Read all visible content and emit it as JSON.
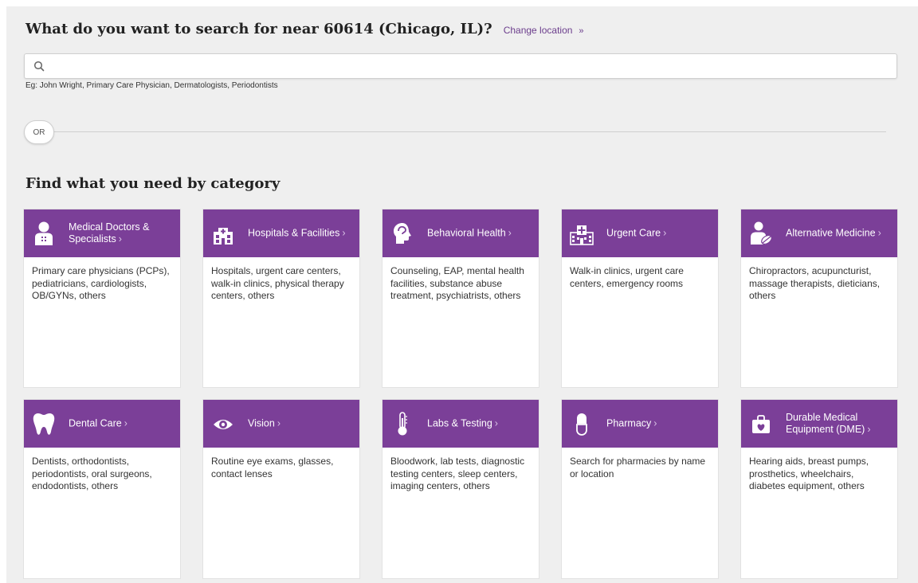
{
  "header": {
    "question": "What do you want to search for near 60614 (Chicago, IL)?",
    "change_location": "Change location",
    "change_chevron": "»"
  },
  "search": {
    "value": "",
    "placeholder": "",
    "hint": "Eg: John Wright, Primary Care Physician, Dermatologists, Periodontists"
  },
  "divider": {
    "or_label": "OR"
  },
  "categories_section": {
    "heading": "Find what you need by category",
    "chevron": "›",
    "accent_color": "#7b3f98",
    "items": [
      {
        "title": "Medical Doctors & Specialists",
        "icon": "doctor-icon",
        "description": "Primary care physicians (PCPs), pediatricians, cardiologists, OB/GYNs, others"
      },
      {
        "title": "Hospitals & Facilities",
        "icon": "hospital-building-icon",
        "description": "Hospitals, urgent care centers, walk-in clinics, physical therapy centers, others"
      },
      {
        "title": "Behavioral Health",
        "icon": "head-profile-icon",
        "description": "Counseling, EAP, mental health facilities, substance abuse treatment, psychiatrists, others"
      },
      {
        "title": "Urgent Care",
        "icon": "urgent-care-building-icon",
        "description": "Walk-in clinics, urgent care centers, emergency rooms"
      },
      {
        "title": "Alternative Medicine",
        "icon": "alternative-medicine-icon",
        "description": "Chiropractors, acupuncturist, massage therapists, dieticians, others"
      },
      {
        "title": "Dental Care",
        "icon": "tooth-icon",
        "description": "Dentists, orthodontists, periodontists, oral surgeons, endodontists, others"
      },
      {
        "title": "Vision",
        "icon": "eye-icon",
        "description": "Routine eye exams, glasses, contact lenses"
      },
      {
        "title": "Labs & Testing",
        "icon": "thermometer-icon",
        "description": "Bloodwork, lab tests, diagnostic testing centers, sleep centers, imaging centers, others"
      },
      {
        "title": "Pharmacy",
        "icon": "pill-icon",
        "description": "Search for pharmacies by name or location"
      },
      {
        "title": "Durable Medical Equipment (DME)",
        "icon": "medical-bag-icon",
        "description": "Hearing aids, breast pumps, prosthetics, wheelchairs, diabetes equipment, others"
      }
    ]
  }
}
